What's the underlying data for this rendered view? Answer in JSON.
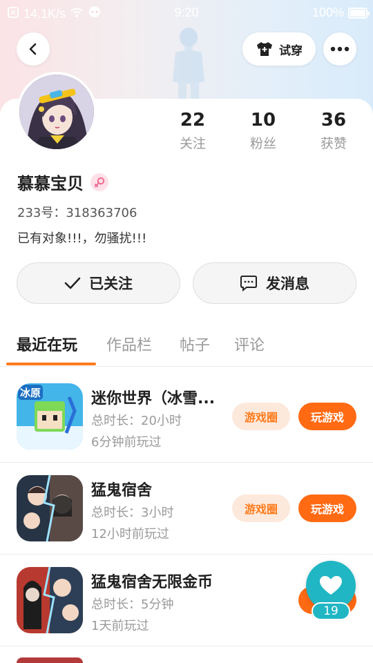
{
  "status_bar": {
    "speed": "14.1K/s",
    "time": "9:20",
    "battery": "100%",
    "battery_level": 1.0
  },
  "header": {
    "try_on_label": "试穿"
  },
  "profile": {
    "stats": [
      {
        "value": "22",
        "label": "关注"
      },
      {
        "value": "10",
        "label": "粉丝"
      },
      {
        "value": "36",
        "label": "获赞"
      }
    ],
    "username": "慕慕宝贝",
    "gender": "female",
    "uid": "233号：318363706",
    "bio": "已有对象!!!，勿骚扰!!!"
  },
  "actions": {
    "follow_label": "已关注",
    "message_label": "发消息"
  },
  "tabs": [
    {
      "label": "最近在玩",
      "active": true
    },
    {
      "label": "作品栏",
      "active": false
    },
    {
      "label": "帖子",
      "active": false
    },
    {
      "label": "评论",
      "active": false
    }
  ],
  "games": [
    {
      "title": "迷你世界（冰雪...",
      "duration": "总时长：20小时",
      "last_played": "6分钟前玩过",
      "circle_label": "游戏圈",
      "play_label": "玩游戏",
      "icon_badge": "冰原"
    },
    {
      "title": "猛鬼宿舍",
      "duration": "总时长：3小时",
      "last_played": "12小时前玩过",
      "circle_label": "游戏圈",
      "play_label": "玩游戏"
    },
    {
      "title": "猛鬼宿舍无限金币",
      "duration": "总时长：5分钟",
      "last_played": "1天前玩过"
    }
  ],
  "floating_like": {
    "count": "19",
    "color": "#20b6c4"
  },
  "colors": {
    "accent": "#ff6a13",
    "accent_light": "#fde9dc"
  }
}
